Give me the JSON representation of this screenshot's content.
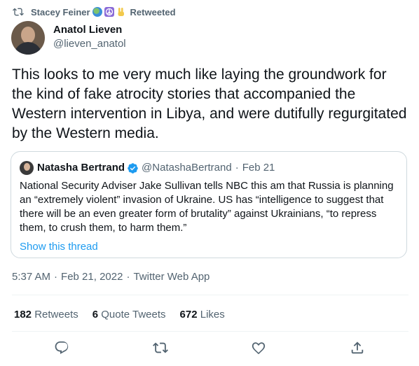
{
  "retweet": {
    "user": "Stacey Feiner",
    "label": "Retweeted",
    "emojis": [
      "globe-icon",
      "peace-icon",
      "victory-hand-icon"
    ]
  },
  "tweet": {
    "author_name": "Anatol Lieven",
    "author_handle": "@lieven_anatol",
    "text": "This looks to me very much like laying the groundwork for the kind of fake atrocity stories that accompanied the Western intervention in Libya, and were dutifully regurgitated by the Western media.",
    "time": "5:37 AM",
    "date": "Feb 21, 2022",
    "source": "Twitter Web App"
  },
  "quote": {
    "author_name": "Natasha Bertrand",
    "author_handle": "@NatashaBertrand",
    "date": "Feb 21",
    "text": "National Security Adviser Jake Sullivan tells NBC this am that Russia is planning an “extremely violent” invasion of Ukraine. US has “intelligence to suggest that there will be an even greater form of brutality” against Ukrainians, “to repress them, to crush them, to harm them.”",
    "show_thread": "Show this thread"
  },
  "stats": {
    "retweets_count": "182",
    "retweets_label": "Retweets",
    "quotes_count": "6",
    "quotes_label": "Quote Tweets",
    "likes_count": "672",
    "likes_label": "Likes"
  },
  "colors": {
    "accent": "#1d9bf0",
    "secondary_text": "#536471",
    "border": "#cfd9de"
  }
}
